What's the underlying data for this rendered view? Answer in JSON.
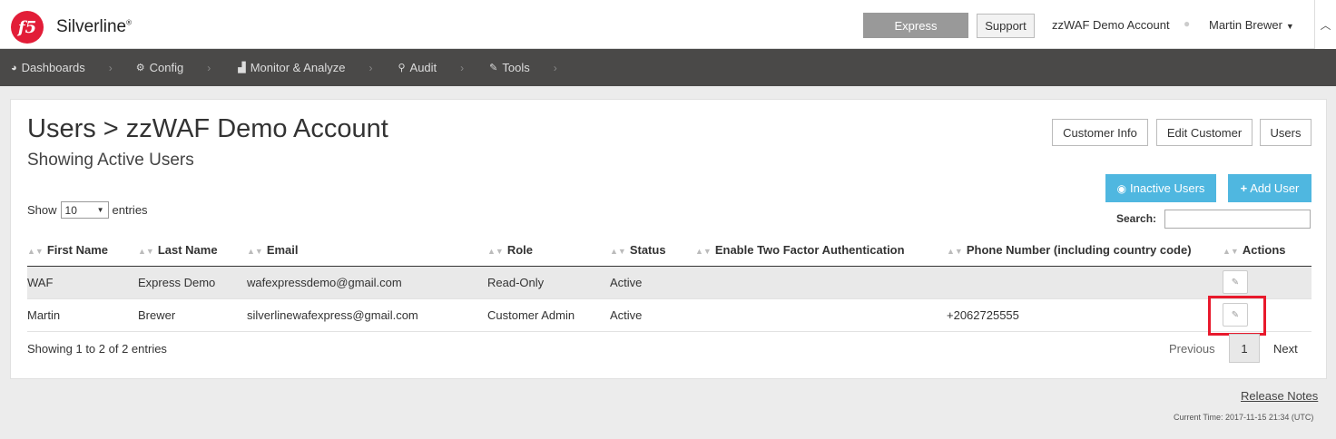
{
  "header": {
    "logo_text": "f5",
    "brand": "Silverline",
    "brand_mark": "®",
    "express_label": "Express",
    "support_label": "Support",
    "account_name": "zzWAF Demo Account",
    "separator": "●",
    "user_name": "Martin Brewer"
  },
  "nav": {
    "items": [
      {
        "label": "Dashboards"
      },
      {
        "label": "Config"
      },
      {
        "label": "Monitor & Analyze"
      },
      {
        "label": "Audit"
      },
      {
        "label": "Tools"
      }
    ]
  },
  "page": {
    "title": "Users > zzWAF Demo Account",
    "subtitle": "Showing Active Users",
    "buttons": {
      "customer_info": "Customer Info",
      "edit_customer": "Edit Customer",
      "users": "Users",
      "inactive_users": "Inactive Users",
      "add_user": "Add User"
    },
    "show_label": "Show",
    "entries_value": "10",
    "entries_label": "entries",
    "search_label": "Search:"
  },
  "table": {
    "columns": [
      "First Name",
      "Last Name",
      "Email",
      "Role",
      "Status",
      "Enable Two Factor Authentication",
      "Phone Number (including country code)",
      "Actions"
    ],
    "rows": [
      {
        "first": "WAF",
        "last": "Express Demo",
        "email": "wafexpressdemo@gmail.com",
        "role": "Read-Only",
        "status": "Active",
        "twofa": "",
        "phone": ""
      },
      {
        "first": "Martin",
        "last": "Brewer",
        "email": "silverlinewafexpress@gmail.com",
        "role": "Customer Admin",
        "status": "Active",
        "twofa": "",
        "phone": "+2062725555"
      }
    ]
  },
  "footer": {
    "info": "Showing 1 to 2 of 2 entries",
    "previous": "Previous",
    "current_page": "1",
    "next": "Next",
    "release_notes": "Release Notes",
    "current_time": "Current Time: 2017-11-15 21:34 (UTC)"
  },
  "colors": {
    "brand_red": "#e21d38",
    "nav_bg": "#4a4948",
    "accent_blue": "#4fb7e0",
    "highlight_red": "#e8192c"
  }
}
